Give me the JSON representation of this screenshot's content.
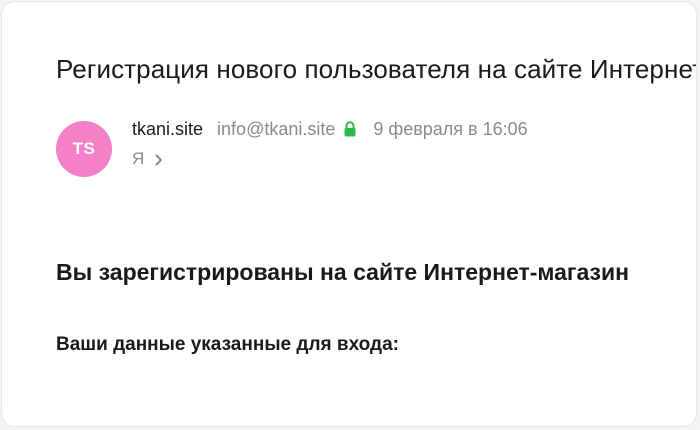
{
  "email": {
    "subject": "Регистрация нового пользователя на сайте Интернет-магазин",
    "avatar_initials": "TS",
    "avatar_color": "#f481c8",
    "sender_name": "tkani.site",
    "sender_email": "info@tkani.site",
    "verified_icon": "lock-icon",
    "verified_color": "#2db84b",
    "date": "9 февраля в 16:06",
    "recipient": "Я",
    "recipient_expand_icon": "chevron-right-icon"
  },
  "body": {
    "heading": "Вы зарегистрированы на сайте Интернет-магазин",
    "subheading": "Ваши данные указанные для входа:"
  }
}
